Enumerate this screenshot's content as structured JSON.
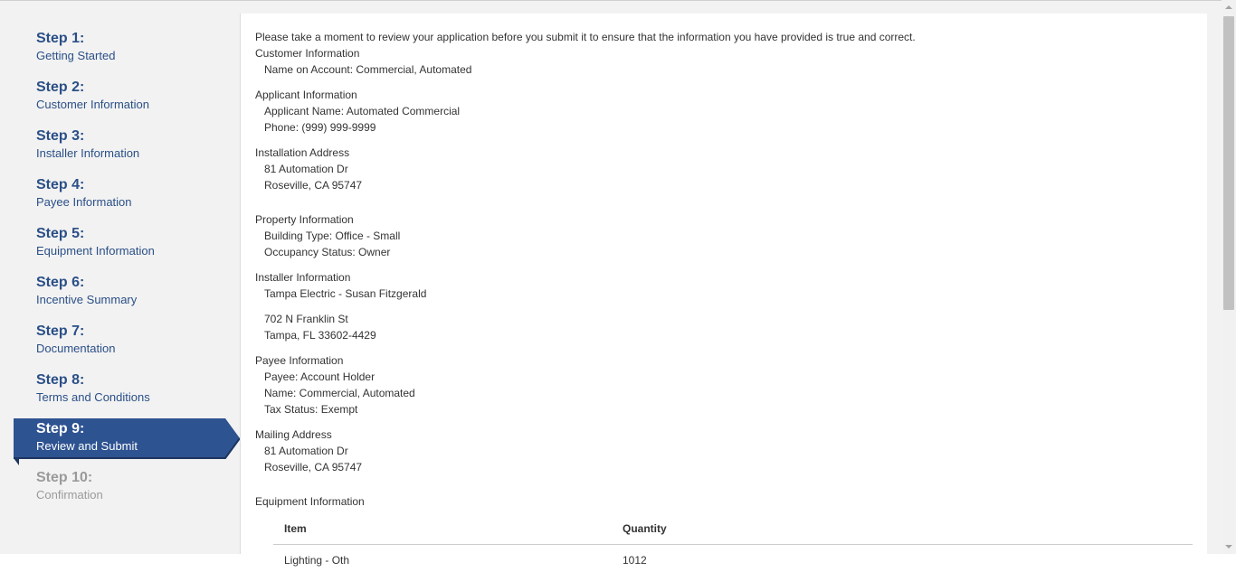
{
  "sidebar": {
    "steps": [
      {
        "number": "Step 1:",
        "label": "Getting Started"
      },
      {
        "number": "Step 2:",
        "label": "Customer Information"
      },
      {
        "number": "Step 3:",
        "label": "Installer Information"
      },
      {
        "number": "Step 4:",
        "label": "Payee Information"
      },
      {
        "number": "Step 5:",
        "label": "Equipment Information"
      },
      {
        "number": "Step 6:",
        "label": "Incentive Summary"
      },
      {
        "number": "Step 7:",
        "label": "Documentation"
      },
      {
        "number": "Step 8:",
        "label": "Terms and Conditions"
      },
      {
        "number": "Step 9:",
        "label": "Review and Submit"
      },
      {
        "number": "Step 10:",
        "label": "Confirmation"
      }
    ],
    "active_step": 9,
    "accent_color": "#2a4f87",
    "active_color": "#2e5391"
  },
  "review": {
    "intro": "Please take a moment to review your application before you submit it to ensure that the information you have provided is true and correct.",
    "customer": {
      "title": "Customer Information",
      "name_on_account": "Name on Account: Commercial, Automated"
    },
    "applicant": {
      "title": "Applicant Information",
      "name": "Applicant Name: Automated Commercial",
      "phone": "Phone: (999) 999-9999"
    },
    "installation": {
      "title": "Installation Address",
      "line1": "81 Automation Dr",
      "line2": "Roseville, CA 95747"
    },
    "property": {
      "title": "Property Information",
      "building_type": "Building Type: Office - Small",
      "occupancy": "Occupancy Status: Owner"
    },
    "installer": {
      "title": "Installer Information",
      "company": "Tampa Electric - Susan Fitzgerald",
      "line1": "702 N Franklin St",
      "line2": "Tampa, FL 33602-4429"
    },
    "payee": {
      "title": "Payee Information",
      "payee": "Payee: Account Holder",
      "name": "Name: Commercial, Automated",
      "tax_status": "Tax Status: Exempt"
    },
    "mailing": {
      "title": "Mailing Address",
      "line1": "81 Automation Dr",
      "line2": "Roseville, CA 95747"
    },
    "equipment": {
      "title": "Equipment Information",
      "columns": [
        "Item",
        "Quantity"
      ],
      "rows": [
        {
          "item": "Lighting - Oth",
          "quantity": "1012"
        }
      ]
    }
  }
}
